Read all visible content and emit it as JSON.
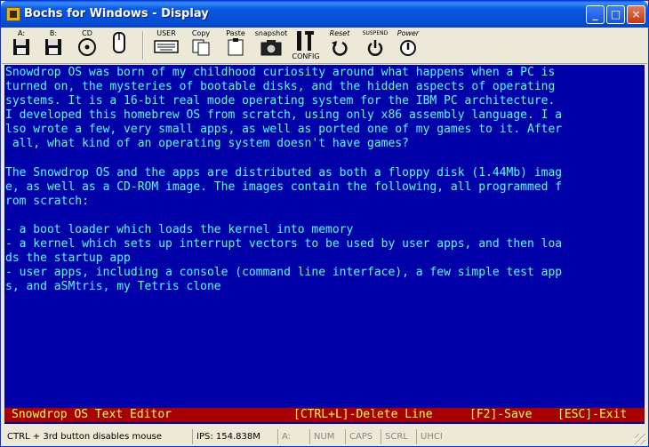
{
  "window": {
    "title": "Bochs for Windows - Display"
  },
  "toolbar": {
    "floppy_a": "A:",
    "floppy_b": "B:",
    "cdrom": "CD",
    "user": "USER",
    "copy": "Copy",
    "paste": "Paste",
    "snapshot": "snapshot",
    "config": "CONFIG",
    "reset": "Reset",
    "suspend": "SUSPEND",
    "power": "Power"
  },
  "screen": {
    "lines": [
      "Snowdrop OS was born of my childhood curiosity around what happens when a PC is",
      "turned on, the mysteries of bootable disks, and the hidden aspects of operating",
      "systems. It is a 16-bit real mode operating system for the IBM PC architecture.",
      "I developed this homebrew OS from scratch, using only x86 assembly language. I a",
      "lso wrote a few, very small apps, as well as ported one of my games to it. After",
      " all, what kind of an operating system doesn't have games?",
      "",
      "The Snowdrop OS and the apps are distributed as both a floppy disk (1.44Mb) imag",
      "e, as well as a CD-ROM image. The images contain the following, all programmed f",
      "rom scratch:",
      "",
      "- a boot loader which loads the kernel into memory",
      "- a kernel which sets up interrupt vectors to be used by user apps, and then loa",
      "ds the startup app",
      "- user apps, including a console (command line interface), a few simple test app",
      "s, and aSMtris, my Tetris clone"
    ],
    "status": {
      "app": "Snowdrop OS Text Editor",
      "delete_line": "[CTRL+L]-Delete Line",
      "save": "[F2]-Save",
      "exit": "[ESC]-Exit"
    },
    "colors": {
      "background": "#0000a8",
      "text": "#55ffff",
      "status_bg": "#a80000",
      "status_text": "#ffff55"
    }
  },
  "statusbar": {
    "hint": "CTRL + 3rd button disables mouse",
    "ips": "IPS: 154.838M",
    "drive": "A:",
    "num": "NUM",
    "caps": "CAPS",
    "scrl": "SCRL",
    "uhci": "UHCI"
  }
}
